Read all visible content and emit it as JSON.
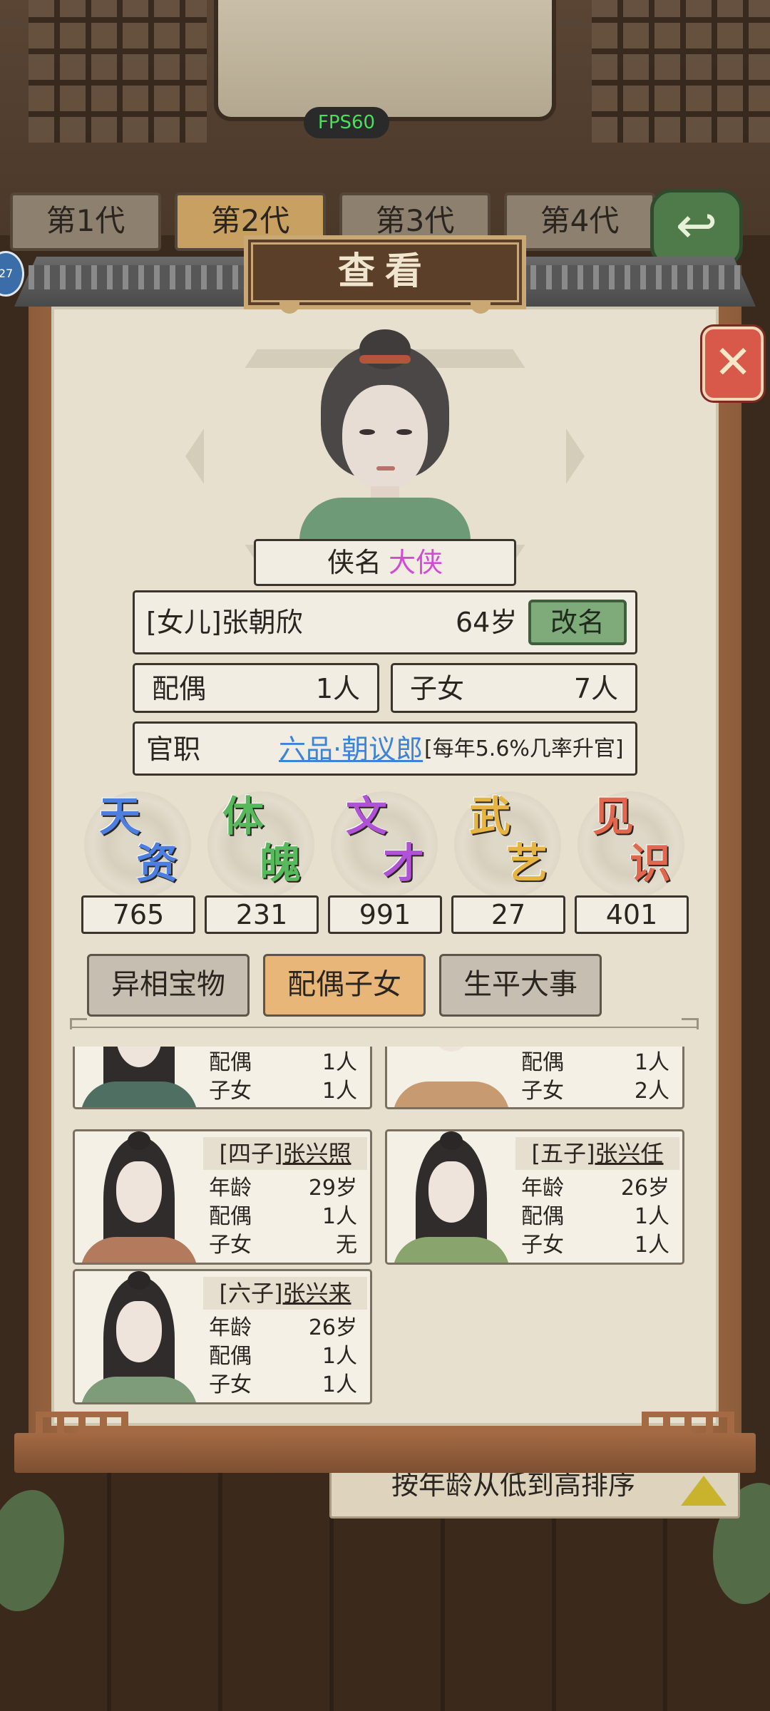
{
  "fps": "FPS60",
  "generation_tabs": [
    "第1代",
    "第2代",
    "第3代",
    "第4代"
  ],
  "left_badge": "27",
  "modal": {
    "title": "查看",
    "close_label": "✕"
  },
  "profile": {
    "nickname_label": "侠名",
    "nickname": "大侠",
    "relation_name": "[女儿]张朝欣",
    "age": "64岁",
    "rename_label": "改名",
    "spouse_label": "配偶",
    "spouse_count": "1人",
    "children_label": "子女",
    "children_count": "7人",
    "official_label": "官职",
    "official_rank": "六品·朝议郎",
    "promotion_rate": "[每年5.6%几率升官]"
  },
  "attributes": [
    {
      "c1": "天",
      "c2": "资",
      "value": "765",
      "color": "#4c7fe0"
    },
    {
      "c1": "体",
      "c2": "魄",
      "value": "231",
      "color": "#57b85c"
    },
    {
      "c1": "文",
      "c2": "才",
      "value": "991",
      "color": "#b052d6"
    },
    {
      "c1": "武",
      "c2": "艺",
      "value": "27",
      "color": "#e6b442"
    },
    {
      "c1": "见",
      "c2": "识",
      "value": "401",
      "color": "#e0684e"
    }
  ],
  "section_tabs": [
    "异相宝物",
    "配偶子女",
    "生平大事"
  ],
  "field_labels": {
    "age": "年龄",
    "spouse": "配偶",
    "children": "子女"
  },
  "children": [
    {
      "relation": "",
      "name": "",
      "age": "",
      "spouse": "1人",
      "children": "1人"
    },
    {
      "relation": "",
      "name": "",
      "age": "",
      "spouse": "1人",
      "children": "2人"
    },
    {
      "relation": "[四子]",
      "name": "张兴照",
      "age": "29岁",
      "spouse": "1人",
      "children": "无"
    },
    {
      "relation": "[五子]",
      "name": "张兴任",
      "age": "26岁",
      "spouse": "1人",
      "children": "1人"
    },
    {
      "relation": "[六子]",
      "name": "张兴来",
      "age": "26岁",
      "spouse": "1人",
      "children": "1人"
    }
  ],
  "sort_label": "按年龄从低到高排序",
  "colors": {
    "nickname": "#d24ad6",
    "official_rank": "#3c84d8",
    "active_tab": "#e8b678",
    "rename_button": "#7faa7a",
    "close_button": "#d8584a",
    "fps_text": "#48e05a"
  },
  "icons": {
    "close": "close-icon",
    "back": "back-arrow-icon",
    "sort": "sort-triangle-icon"
  }
}
